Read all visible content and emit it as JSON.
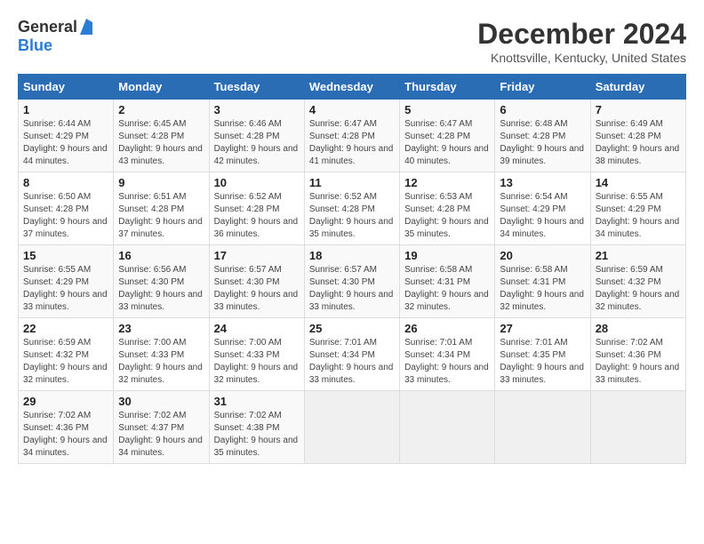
{
  "header": {
    "logo_general": "General",
    "logo_blue": "Blue",
    "title": "December 2024",
    "subtitle": "Knottsville, Kentucky, United States"
  },
  "weekdays": [
    "Sunday",
    "Monday",
    "Tuesday",
    "Wednesday",
    "Thursday",
    "Friday",
    "Saturday"
  ],
  "weeks": [
    [
      {
        "day": "1",
        "sunrise": "6:44 AM",
        "sunset": "4:29 PM",
        "daylight": "9 hours and 44 minutes."
      },
      {
        "day": "2",
        "sunrise": "6:45 AM",
        "sunset": "4:28 PM",
        "daylight": "9 hours and 43 minutes."
      },
      {
        "day": "3",
        "sunrise": "6:46 AM",
        "sunset": "4:28 PM",
        "daylight": "9 hours and 42 minutes."
      },
      {
        "day": "4",
        "sunrise": "6:47 AM",
        "sunset": "4:28 PM",
        "daylight": "9 hours and 41 minutes."
      },
      {
        "day": "5",
        "sunrise": "6:47 AM",
        "sunset": "4:28 PM",
        "daylight": "9 hours and 40 minutes."
      },
      {
        "day": "6",
        "sunrise": "6:48 AM",
        "sunset": "4:28 PM",
        "daylight": "9 hours and 39 minutes."
      },
      {
        "day": "7",
        "sunrise": "6:49 AM",
        "sunset": "4:28 PM",
        "daylight": "9 hours and 38 minutes."
      }
    ],
    [
      {
        "day": "8",
        "sunrise": "6:50 AM",
        "sunset": "4:28 PM",
        "daylight": "9 hours and 37 minutes."
      },
      {
        "day": "9",
        "sunrise": "6:51 AM",
        "sunset": "4:28 PM",
        "daylight": "9 hours and 37 minutes."
      },
      {
        "day": "10",
        "sunrise": "6:52 AM",
        "sunset": "4:28 PM",
        "daylight": "9 hours and 36 minutes."
      },
      {
        "day": "11",
        "sunrise": "6:52 AM",
        "sunset": "4:28 PM",
        "daylight": "9 hours and 35 minutes."
      },
      {
        "day": "12",
        "sunrise": "6:53 AM",
        "sunset": "4:28 PM",
        "daylight": "9 hours and 35 minutes."
      },
      {
        "day": "13",
        "sunrise": "6:54 AM",
        "sunset": "4:29 PM",
        "daylight": "9 hours and 34 minutes."
      },
      {
        "day": "14",
        "sunrise": "6:55 AM",
        "sunset": "4:29 PM",
        "daylight": "9 hours and 34 minutes."
      }
    ],
    [
      {
        "day": "15",
        "sunrise": "6:55 AM",
        "sunset": "4:29 PM",
        "daylight": "9 hours and 33 minutes."
      },
      {
        "day": "16",
        "sunrise": "6:56 AM",
        "sunset": "4:30 PM",
        "daylight": "9 hours and 33 minutes."
      },
      {
        "day": "17",
        "sunrise": "6:57 AM",
        "sunset": "4:30 PM",
        "daylight": "9 hours and 33 minutes."
      },
      {
        "day": "18",
        "sunrise": "6:57 AM",
        "sunset": "4:30 PM",
        "daylight": "9 hours and 33 minutes."
      },
      {
        "day": "19",
        "sunrise": "6:58 AM",
        "sunset": "4:31 PM",
        "daylight": "9 hours and 32 minutes."
      },
      {
        "day": "20",
        "sunrise": "6:58 AM",
        "sunset": "4:31 PM",
        "daylight": "9 hours and 32 minutes."
      },
      {
        "day": "21",
        "sunrise": "6:59 AM",
        "sunset": "4:32 PM",
        "daylight": "9 hours and 32 minutes."
      }
    ],
    [
      {
        "day": "22",
        "sunrise": "6:59 AM",
        "sunset": "4:32 PM",
        "daylight": "9 hours and 32 minutes."
      },
      {
        "day": "23",
        "sunrise": "7:00 AM",
        "sunset": "4:33 PM",
        "daylight": "9 hours and 32 minutes."
      },
      {
        "day": "24",
        "sunrise": "7:00 AM",
        "sunset": "4:33 PM",
        "daylight": "9 hours and 32 minutes."
      },
      {
        "day": "25",
        "sunrise": "7:01 AM",
        "sunset": "4:34 PM",
        "daylight": "9 hours and 33 minutes."
      },
      {
        "day": "26",
        "sunrise": "7:01 AM",
        "sunset": "4:34 PM",
        "daylight": "9 hours and 33 minutes."
      },
      {
        "day": "27",
        "sunrise": "7:01 AM",
        "sunset": "4:35 PM",
        "daylight": "9 hours and 33 minutes."
      },
      {
        "day": "28",
        "sunrise": "7:02 AM",
        "sunset": "4:36 PM",
        "daylight": "9 hours and 33 minutes."
      }
    ],
    [
      {
        "day": "29",
        "sunrise": "7:02 AM",
        "sunset": "4:36 PM",
        "daylight": "9 hours and 34 minutes."
      },
      {
        "day": "30",
        "sunrise": "7:02 AM",
        "sunset": "4:37 PM",
        "daylight": "9 hours and 34 minutes."
      },
      {
        "day": "31",
        "sunrise": "7:02 AM",
        "sunset": "4:38 PM",
        "daylight": "9 hours and 35 minutes."
      },
      null,
      null,
      null,
      null
    ]
  ],
  "labels": {
    "sunrise": "Sunrise:",
    "sunset": "Sunset:",
    "daylight": "Daylight:"
  }
}
